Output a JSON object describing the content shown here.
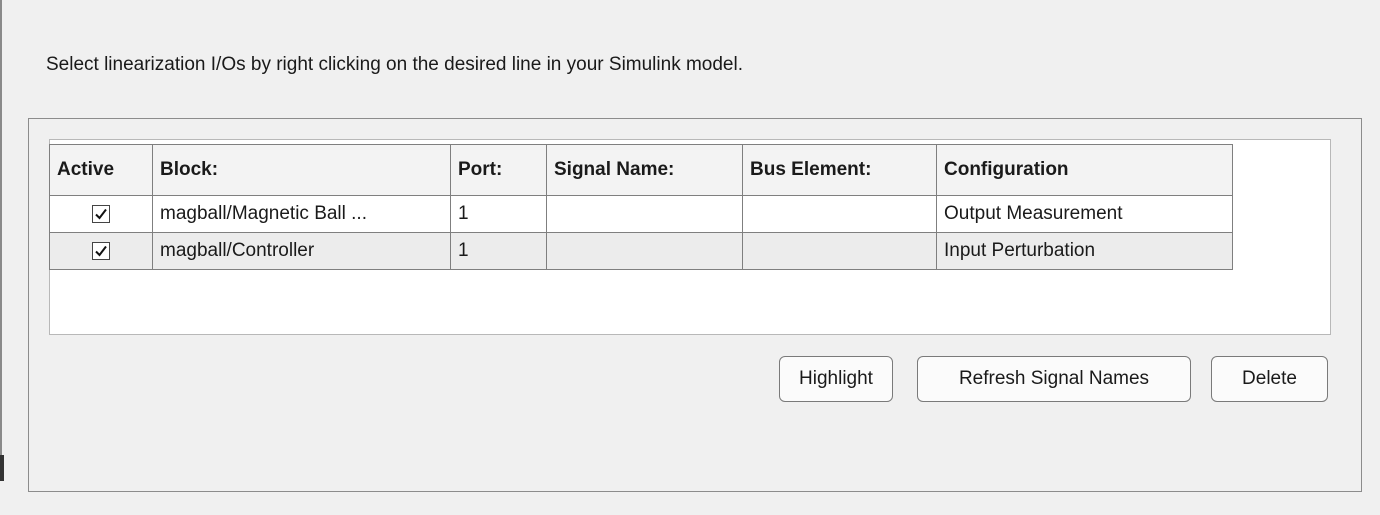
{
  "instruction": "Select linearization I/Os by right clicking on the desired line in your Simulink model.",
  "table": {
    "headers": {
      "active": "Active",
      "block": "Block:",
      "port": "Port:",
      "signal_name": "Signal Name:",
      "bus_element": "Bus Element:",
      "configuration": "Configuration"
    },
    "rows": [
      {
        "active": true,
        "block": "magball/Magnetic Ball ...",
        "port": "1",
        "signal_name": "",
        "bus_element": "",
        "configuration": "Output Measurement"
      },
      {
        "active": true,
        "block": "magball/Controller",
        "port": "1",
        "signal_name": "",
        "bus_element": "",
        "configuration": "Input Perturbation"
      }
    ]
  },
  "buttons": {
    "highlight": "Highlight",
    "refresh": "Refresh Signal Names",
    "delete": "Delete"
  },
  "icons": {
    "checkbox": "checkmark-icon"
  }
}
